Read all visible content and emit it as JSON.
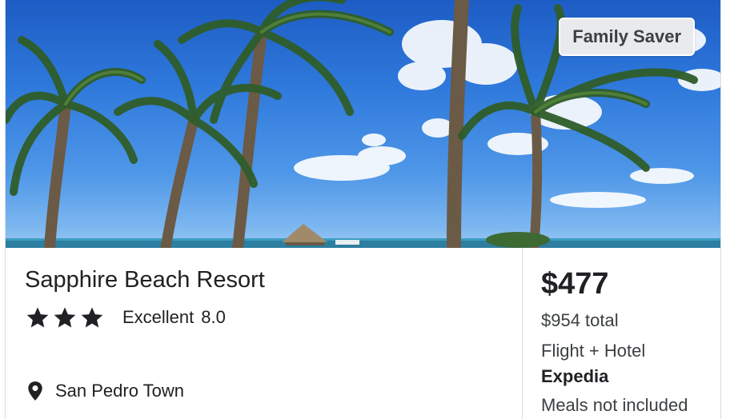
{
  "listing": {
    "badge": "Family Saver",
    "hotel_name": "Sapphire Beach Resort",
    "star_rating": 3,
    "rating_label": "Excellent",
    "rating_score": "8.0",
    "location": "San Pedro Town",
    "price": "$477",
    "total": "$954 total",
    "package": "Flight + Hotel",
    "provider": "Expedia",
    "meals": "Meals not included"
  },
  "icons": {
    "star": "star-icon",
    "pin": "location-pin-icon"
  },
  "colors": {
    "text": "#202124",
    "badge_bg": "#e8eaed"
  }
}
